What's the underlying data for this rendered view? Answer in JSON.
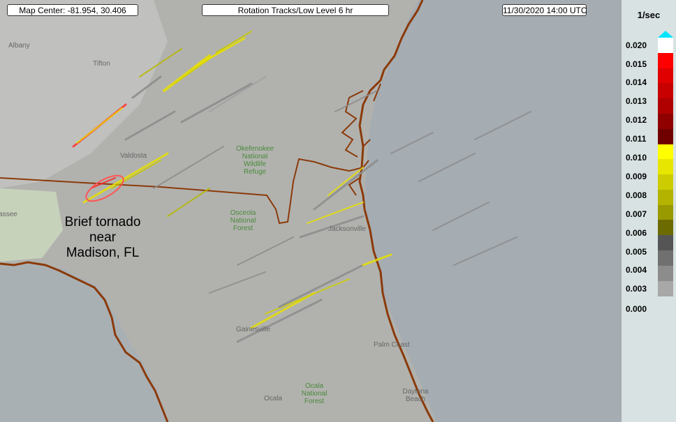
{
  "header": {
    "map_center": "Map Center: -81.954, 30.406",
    "product": "Rotation Tracks/Low Level 6 hr",
    "datetime": "11/30/2020  14:00 UTC"
  },
  "annotation": {
    "line1": "Brief tornado",
    "line2": "near",
    "line3": "Madison, FL"
  },
  "places": {
    "albany": "Albany",
    "tifton": "Tifton",
    "valdosta": "Valdosta",
    "tallahassee": "Tallahassee",
    "okefenokee": "Okefenokee National Wildlife Refuge",
    "osceola": "Osceola National Forest",
    "jacksonville": "Jacksonville",
    "gainesville": "Gainesville",
    "palm_coast": "Palm Coast",
    "ocala": "Ocala",
    "ocala_forest": "Ocala National Forest",
    "daytona": "Daytona Beach"
  },
  "legend": {
    "unit": "1/sec",
    "labels": [
      "0.020",
      "0.015",
      "0.014",
      "0.013",
      "0.012",
      "0.011",
      "0.010",
      "0.009",
      "0.008",
      "0.007",
      "0.006",
      "0.005",
      "0.004",
      "0.003",
      "0.000"
    ],
    "colors": [
      "#00e5ff",
      "#ffffff",
      "#ff0000",
      "#e00000",
      "#c80000",
      "#b00000",
      "#900000",
      "#700000",
      "#ffff00",
      "#e6e600",
      "#cccc00",
      "#b3b300",
      "#999900",
      "#6b6b00",
      "#555555",
      "#707070",
      "#8c8c8c",
      "#a8a8a8"
    ]
  },
  "colors": {
    "state_border": "#8b3a0a",
    "coast": "#8b3a0a",
    "ocean": "#a9adb0",
    "land": "#b0b0ac"
  }
}
